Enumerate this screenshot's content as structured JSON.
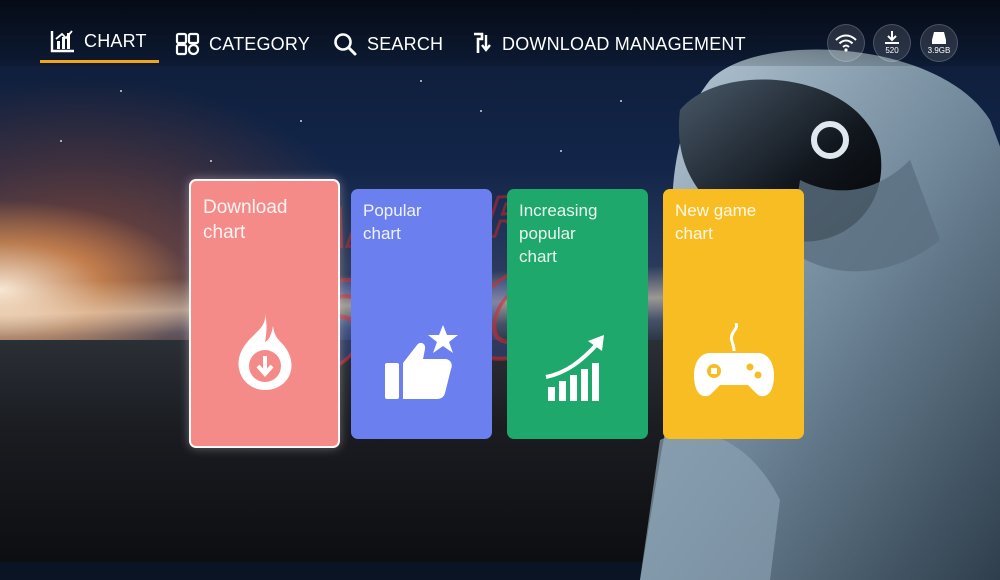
{
  "nav": {
    "items": [
      {
        "label": "CHART",
        "icon": "chart-icon",
        "active": true
      },
      {
        "label": "CATEGORY",
        "icon": "category-icon",
        "active": false
      },
      {
        "label": "SEARCH",
        "icon": "search-icon",
        "active": false
      },
      {
        "label": "DOWNLOAD MANAGEMENT",
        "icon": "download-management-icon",
        "active": false
      }
    ]
  },
  "status": {
    "download_count": "520",
    "storage": "3.9GB"
  },
  "cards": [
    {
      "title_line1": "Download",
      "title_line2": "chart",
      "title_line3": "",
      "color": "#f48b88",
      "icon": "fire-download-icon"
    },
    {
      "title_line1": "Popular",
      "title_line2": "chart",
      "title_line3": "",
      "color": "#6b80ee",
      "icon": "thumbs-up-star-icon"
    },
    {
      "title_line1": "Increasing",
      "title_line2": "popular",
      "title_line3": "chart",
      "color": "#1fa86b",
      "icon": "rising-bars-icon"
    },
    {
      "title_line1": "New game",
      "title_line2": "chart",
      "title_line3": "",
      "color": "#f7bd23",
      "icon": "gamepad-icon"
    }
  ],
  "watermark": {
    "line1": "PANDORA",
    "line2": "SAGA"
  },
  "colors": {
    "accent": "#f3a51a"
  }
}
